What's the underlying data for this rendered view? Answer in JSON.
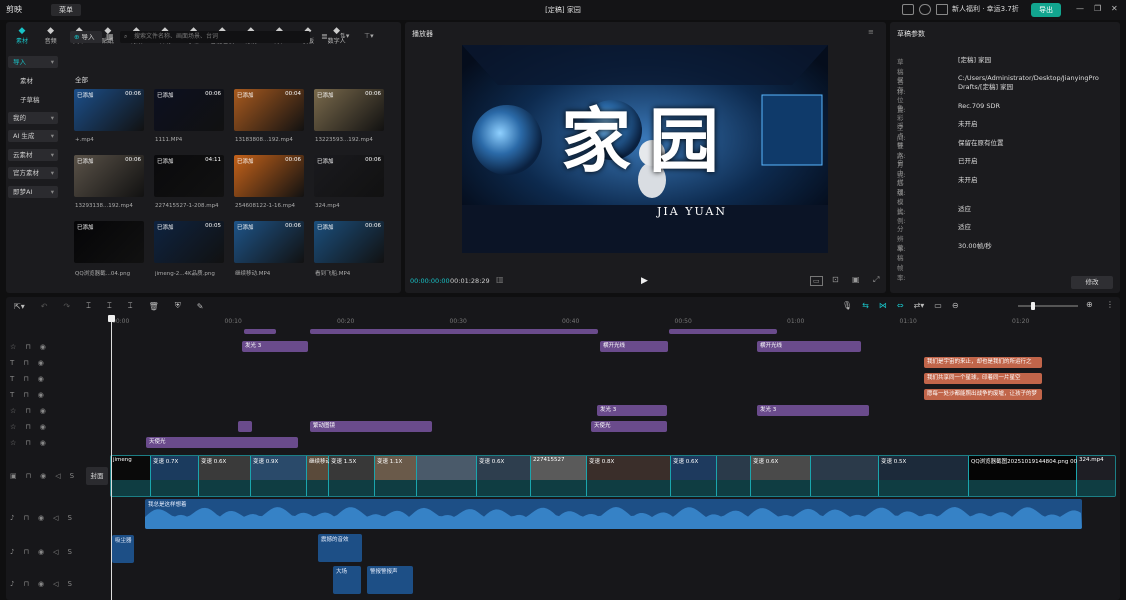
{
  "titlebar": {
    "app_name": "剪映",
    "menu_label": "菜单",
    "window_title": "[定稿] 家园",
    "promo_text": "新人福利 · 幸运3.7折",
    "export_label": "导出"
  },
  "media": {
    "tabs": [
      {
        "label": "素材",
        "icon": "media-icon"
      },
      {
        "label": "音频",
        "icon": "audio-icon"
      },
      {
        "label": "文本",
        "icon": "text-icon"
      },
      {
        "label": "贴纸",
        "icon": "sticker-icon"
      },
      {
        "label": "特效",
        "icon": "effects-icon"
      },
      {
        "label": "转场",
        "icon": "transition-icon"
      },
      {
        "label": "字幕",
        "icon": "caption-icon"
      },
      {
        "label": "智能包装",
        "icon": "smart-pack-icon"
      },
      {
        "label": "滤镜",
        "icon": "filter-icon"
      },
      {
        "label": "调节",
        "icon": "adjust-icon"
      },
      {
        "label": "模板",
        "icon": "template-icon"
      },
      {
        "label": "数字人",
        "icon": "avatar-icon"
      }
    ],
    "sidebar": [
      "导入",
      "素材",
      "子草稿",
      "我的",
      "AI 生成",
      "云素材",
      "官方素材",
      "即梦AI"
    ],
    "import_label": "导入",
    "search_placeholder": "搜索文件名称、画面场景、台词",
    "section_all": "全部",
    "items": [
      {
        "badge": "已添加",
        "duration": "00:06",
        "name": "+.mp4"
      },
      {
        "badge": "已添加",
        "duration": "00:06",
        "name": "1111.MP4"
      },
      {
        "badge": "已添加",
        "duration": "00:04",
        "name": "13183808...192.mp4"
      },
      {
        "badge": "已添加",
        "duration": "00:06",
        "name": "13223593...192.mp4"
      },
      {
        "badge": "已添加",
        "duration": "00:06",
        "name": "13293138...192.mp4"
      },
      {
        "badge": "已添加",
        "duration": "04:11",
        "name": "227415527-1-208.mp4"
      },
      {
        "badge": "已添加",
        "duration": "00:06",
        "name": "254608122-1-16.mp4"
      },
      {
        "badge": "已添加",
        "duration": "00:06",
        "name": "324.mp4"
      },
      {
        "badge": "已添加",
        "duration": "",
        "name": "QQ浏览器截...04.png"
      },
      {
        "badge": "已添加",
        "duration": "00:05",
        "name": "jimeng-2...4K品质.png"
      },
      {
        "badge": "已添加",
        "duration": "00:06",
        "name": "继续移动.MP4"
      },
      {
        "badge": "已添加",
        "duration": "00:06",
        "name": "看到飞船.MP4"
      }
    ]
  },
  "player": {
    "title": "播放器",
    "current_time": "00:00:00:00",
    "total_time": "00:01:28:29",
    "overlay_title": "家园",
    "overlay_subtitle": "JIA YUAN"
  },
  "draft": {
    "title": "草稿参数",
    "fields": [
      {
        "key": "草稿名称:",
        "value": "[定稿] 家园"
      },
      {
        "key": "保存位置:",
        "value": "C:/Users/Administrator/Desktop/JianyingPro Drafts/[定稿] 家园"
      },
      {
        "key": "色彩空间:",
        "value": "Rec.709 SDR"
      },
      {
        "key": "浮点链路:",
        "value": "未开启"
      },
      {
        "key": "导入方式:",
        "value": "保留在原有位置"
      },
      {
        "key": "自由层级:",
        "value": "已开启"
      },
      {
        "key": "代理模式:",
        "value": "未开启"
      },
      {
        "key": "比例:",
        "value": "适应"
      },
      {
        "key": "分辨率:",
        "value": "适应"
      },
      {
        "key": "草稿帧率:",
        "value": "30.00帧/秒"
      }
    ],
    "modify_label": "修改"
  },
  "timeline": {
    "ruler": [
      "00:00",
      "00:10",
      "00:20",
      "00:30",
      "00:40",
      "00:50",
      "01:00",
      "01:10",
      "01:20"
    ],
    "cover_label": "封面",
    "effect_clips": [
      {
        "row": 0,
        "label": "发光 3"
      },
      {
        "row": 0,
        "label": "横开光线"
      },
      {
        "row": 0,
        "label": "横开光线"
      },
      {
        "row": 4,
        "label": "发光 3"
      },
      {
        "row": 4,
        "label": "发光 3"
      },
      {
        "row": 5,
        "label": ""
      },
      {
        "row": 5,
        "label": "繁动图镜"
      },
      {
        "row": 5,
        "label": "天使光"
      },
      {
        "row": 6,
        "label": "天使光"
      }
    ],
    "text_clips": [
      "我们是宇宙的来止，却也是我们的所运行之",
      "我们共享同一个星球，印着同一片星空",
      "愿每一处沙都能照出战争的废墟，让孩子的梦"
    ],
    "video_labels": [
      "jimeng",
      "变速 0.7X",
      "变速 0.6X",
      "变速 0.9X",
      "继续移动",
      "变速 1.5X",
      "变速 1.1X",
      "变速 0.6X",
      "227415527",
      "变速 0.8X",
      "变速 0.6X",
      "变速 0.6X",
      "变速 0.5X",
      "QQ浏览器截图20251019144804.png 00:00:14:28",
      "324.mp4"
    ],
    "audio_main": "我总是这样想着",
    "audio_sfx": [
      {
        "label": "吸尘器"
      },
      {
        "label": "震撼的音效"
      },
      {
        "label": "大场"
      },
      {
        "label": "警报警报声"
      }
    ]
  }
}
